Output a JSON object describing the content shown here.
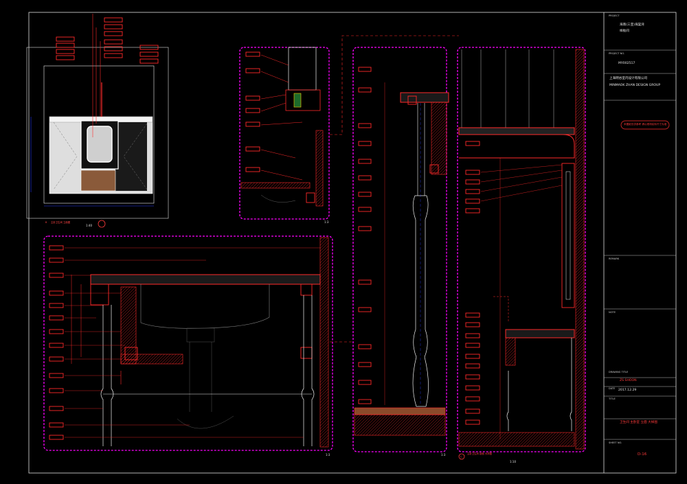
{
  "title_block": {
    "project_label": "PROJECT",
    "project_line1": "海南(三亚)海棠湾",
    "project_line2": "样板间",
    "project_no_label": "PROJECT NO.",
    "project_no": "MY002517",
    "company_cn": "上海明谷室内设计有限公司",
    "company_en": "MINMAOK ZHAN DESIGN GROUP",
    "stamp_text": "本图纸仅供参考 请以现场实际尺寸为准",
    "remark_label": "REMARK",
    "note_label": "NOTE",
    "drawing_title_label": "DRAWING TITLE",
    "drawn_by": "ZS SHOON",
    "date_label": "DATE",
    "date": "2017.12.29",
    "title_label": "TITLE",
    "drawing_title": "卫生间 主卧室 立面 大样图",
    "sheet_no_label": "SHEET NO.",
    "sheet_no": "D-16"
  },
  "views": {
    "elevation_tag": "B",
    "elevation_title": "主卧卫生间 立面图",
    "elevation_scale": "1:40",
    "detail1_scale": "1:3",
    "detail2_scale": "1:3",
    "detail3_scale": "1:3",
    "section_tag": "C",
    "section_title": "主卧卫生间 剖面 大样图",
    "section_scale": "1:10"
  },
  "colors": {
    "background": "#000000",
    "viewport_frame": "#ff00ff",
    "linework": "#f2f2f2",
    "callout": "#ff2a2a",
    "dimension": "#2a3cff"
  }
}
